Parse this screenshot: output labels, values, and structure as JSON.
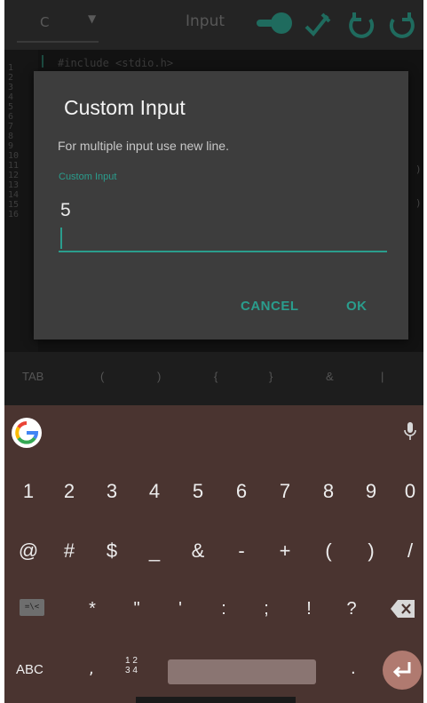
{
  "toolbar": {
    "language": "C",
    "tab_label": "Input",
    "accent_color": "#1f6b5e"
  },
  "editor": {
    "line_numbers": [
      "1",
      "2",
      "3",
      "4",
      "5",
      "6",
      "7",
      "8",
      "9",
      "10",
      "11",
      "12",
      "13",
      "14",
      "15",
      "16"
    ],
    "first_line": "#include <stdio.h>",
    "paren_right_1": ")",
    "paren_right_2": ")"
  },
  "dialog": {
    "title": "Custom Input",
    "message": "For multiple input use new line.",
    "field_label": "Custom Input",
    "field_value": "5",
    "cancel_label": "CANCEL",
    "ok_label": "OK",
    "accent_color": "#2a9d8d"
  },
  "symbol_bar": {
    "items": [
      "TAB",
      "(",
      ")",
      "{",
      "}",
      "&",
      "|"
    ]
  },
  "keyboard": {
    "numbers": [
      "1",
      "2",
      "3",
      "4",
      "5",
      "6",
      "7",
      "8",
      "9",
      "0"
    ],
    "symbols_row": [
      "@",
      "#",
      "$",
      "_",
      "&",
      "-",
      "+",
      "(",
      ")",
      "/"
    ],
    "symbols_row2": [
      "*",
      "\"",
      "'",
      ":",
      ";",
      "!",
      "?"
    ],
    "emoji_switch_label": "=\\<",
    "abc_label": "ABC",
    "comma_label": ",",
    "numpad_top": "1 2",
    "numpad_bottom": "3 4",
    "period_label": ".",
    "background_color": "#4a3430",
    "enter_color": "#b07a70"
  }
}
